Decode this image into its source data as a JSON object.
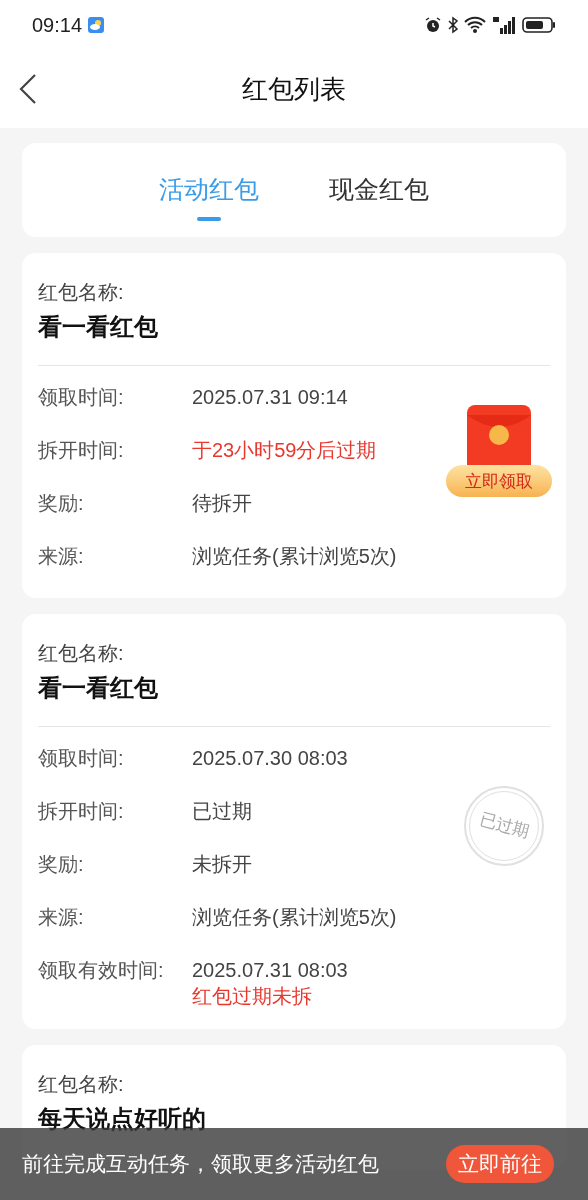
{
  "status_bar": {
    "time": "09:14"
  },
  "header": {
    "title": "红包列表"
  },
  "tabs": [
    {
      "label": "活动红包",
      "selected": true
    },
    {
      "label": "现金红包",
      "selected": false
    }
  ],
  "cards": [
    {
      "name_label": "红包名称:",
      "name": "看一看红包",
      "badge": {
        "kind": "claim",
        "button": "立即领取"
      },
      "rows": [
        {
          "label": "领取时间:",
          "values": [
            {
              "text": "2025.07.31 09:14",
              "alert": false
            }
          ]
        },
        {
          "label": "拆开时间:",
          "values": [
            {
              "text": "于23小时59分后过期",
              "alert": true
            }
          ]
        },
        {
          "label": "奖励:",
          "values": [
            {
              "text": "待拆开",
              "alert": false
            }
          ]
        },
        {
          "label": "来源:",
          "values": [
            {
              "text": "浏览任务(累计浏览5次)",
              "alert": false
            }
          ]
        }
      ]
    },
    {
      "name_label": "红包名称:",
      "name": "看一看红包",
      "badge": {
        "kind": "stamp",
        "text": "已过期"
      },
      "rows": [
        {
          "label": "领取时间:",
          "values": [
            {
              "text": "2025.07.30 08:03",
              "alert": false
            }
          ]
        },
        {
          "label": "拆开时间:",
          "values": [
            {
              "text": "已过期",
              "alert": false
            }
          ]
        },
        {
          "label": "奖励:",
          "values": [
            {
              "text": "未拆开",
              "alert": false
            }
          ]
        },
        {
          "label": "来源:",
          "values": [
            {
              "text": "浏览任务(累计浏览5次)",
              "alert": false
            }
          ]
        },
        {
          "label": "领取有效时间:",
          "values": [
            {
              "text": "2025.07.31 08:03",
              "alert": false
            },
            {
              "text": "红包过期未拆",
              "alert": true
            }
          ]
        }
      ]
    },
    {
      "name_label": "红包名称:",
      "name": "每天说点好听的"
    }
  ],
  "bottom_bar": {
    "message": "前往完成互动任务，领取更多活动红包",
    "button": "立即前往"
  }
}
